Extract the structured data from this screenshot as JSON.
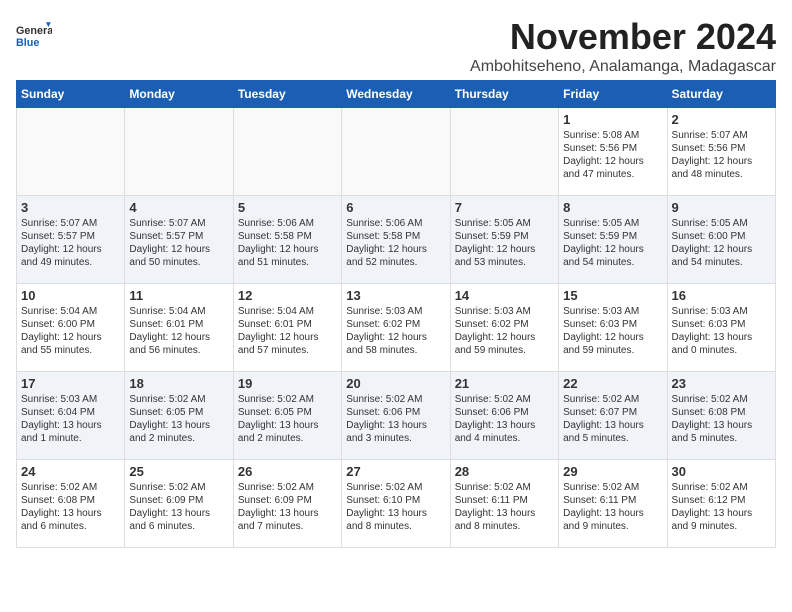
{
  "logo": {
    "text_general": "General",
    "text_blue": "Blue"
  },
  "title": "November 2024",
  "subtitle": "Ambohitseheno, Analamanga, Madagascar",
  "days_of_week": [
    "Sunday",
    "Monday",
    "Tuesday",
    "Wednesday",
    "Thursday",
    "Friday",
    "Saturday"
  ],
  "weeks": [
    [
      {
        "day": "",
        "info": ""
      },
      {
        "day": "",
        "info": ""
      },
      {
        "day": "",
        "info": ""
      },
      {
        "day": "",
        "info": ""
      },
      {
        "day": "",
        "info": ""
      },
      {
        "day": "1",
        "info": "Sunrise: 5:08 AM\nSunset: 5:56 PM\nDaylight: 12 hours\nand 47 minutes."
      },
      {
        "day": "2",
        "info": "Sunrise: 5:07 AM\nSunset: 5:56 PM\nDaylight: 12 hours\nand 48 minutes."
      }
    ],
    [
      {
        "day": "3",
        "info": "Sunrise: 5:07 AM\nSunset: 5:57 PM\nDaylight: 12 hours\nand 49 minutes."
      },
      {
        "day": "4",
        "info": "Sunrise: 5:07 AM\nSunset: 5:57 PM\nDaylight: 12 hours\nand 50 minutes."
      },
      {
        "day": "5",
        "info": "Sunrise: 5:06 AM\nSunset: 5:58 PM\nDaylight: 12 hours\nand 51 minutes."
      },
      {
        "day": "6",
        "info": "Sunrise: 5:06 AM\nSunset: 5:58 PM\nDaylight: 12 hours\nand 52 minutes."
      },
      {
        "day": "7",
        "info": "Sunrise: 5:05 AM\nSunset: 5:59 PM\nDaylight: 12 hours\nand 53 minutes."
      },
      {
        "day": "8",
        "info": "Sunrise: 5:05 AM\nSunset: 5:59 PM\nDaylight: 12 hours\nand 54 minutes."
      },
      {
        "day": "9",
        "info": "Sunrise: 5:05 AM\nSunset: 6:00 PM\nDaylight: 12 hours\nand 54 minutes."
      }
    ],
    [
      {
        "day": "10",
        "info": "Sunrise: 5:04 AM\nSunset: 6:00 PM\nDaylight: 12 hours\nand 55 minutes."
      },
      {
        "day": "11",
        "info": "Sunrise: 5:04 AM\nSunset: 6:01 PM\nDaylight: 12 hours\nand 56 minutes."
      },
      {
        "day": "12",
        "info": "Sunrise: 5:04 AM\nSunset: 6:01 PM\nDaylight: 12 hours\nand 57 minutes."
      },
      {
        "day": "13",
        "info": "Sunrise: 5:03 AM\nSunset: 6:02 PM\nDaylight: 12 hours\nand 58 minutes."
      },
      {
        "day": "14",
        "info": "Sunrise: 5:03 AM\nSunset: 6:02 PM\nDaylight: 12 hours\nand 59 minutes."
      },
      {
        "day": "15",
        "info": "Sunrise: 5:03 AM\nSunset: 6:03 PM\nDaylight: 12 hours\nand 59 minutes."
      },
      {
        "day": "16",
        "info": "Sunrise: 5:03 AM\nSunset: 6:03 PM\nDaylight: 13 hours\nand 0 minutes."
      }
    ],
    [
      {
        "day": "17",
        "info": "Sunrise: 5:03 AM\nSunset: 6:04 PM\nDaylight: 13 hours\nand 1 minute."
      },
      {
        "day": "18",
        "info": "Sunrise: 5:02 AM\nSunset: 6:05 PM\nDaylight: 13 hours\nand 2 minutes."
      },
      {
        "day": "19",
        "info": "Sunrise: 5:02 AM\nSunset: 6:05 PM\nDaylight: 13 hours\nand 2 minutes."
      },
      {
        "day": "20",
        "info": "Sunrise: 5:02 AM\nSunset: 6:06 PM\nDaylight: 13 hours\nand 3 minutes."
      },
      {
        "day": "21",
        "info": "Sunrise: 5:02 AM\nSunset: 6:06 PM\nDaylight: 13 hours\nand 4 minutes."
      },
      {
        "day": "22",
        "info": "Sunrise: 5:02 AM\nSunset: 6:07 PM\nDaylight: 13 hours\nand 5 minutes."
      },
      {
        "day": "23",
        "info": "Sunrise: 5:02 AM\nSunset: 6:08 PM\nDaylight: 13 hours\nand 5 minutes."
      }
    ],
    [
      {
        "day": "24",
        "info": "Sunrise: 5:02 AM\nSunset: 6:08 PM\nDaylight: 13 hours\nand 6 minutes."
      },
      {
        "day": "25",
        "info": "Sunrise: 5:02 AM\nSunset: 6:09 PM\nDaylight: 13 hours\nand 6 minutes."
      },
      {
        "day": "26",
        "info": "Sunrise: 5:02 AM\nSunset: 6:09 PM\nDaylight: 13 hours\nand 7 minutes."
      },
      {
        "day": "27",
        "info": "Sunrise: 5:02 AM\nSunset: 6:10 PM\nDaylight: 13 hours\nand 8 minutes."
      },
      {
        "day": "28",
        "info": "Sunrise: 5:02 AM\nSunset: 6:11 PM\nDaylight: 13 hours\nand 8 minutes."
      },
      {
        "day": "29",
        "info": "Sunrise: 5:02 AM\nSunset: 6:11 PM\nDaylight: 13 hours\nand 9 minutes."
      },
      {
        "day": "30",
        "info": "Sunrise: 5:02 AM\nSunset: 6:12 PM\nDaylight: 13 hours\nand 9 minutes."
      }
    ]
  ]
}
